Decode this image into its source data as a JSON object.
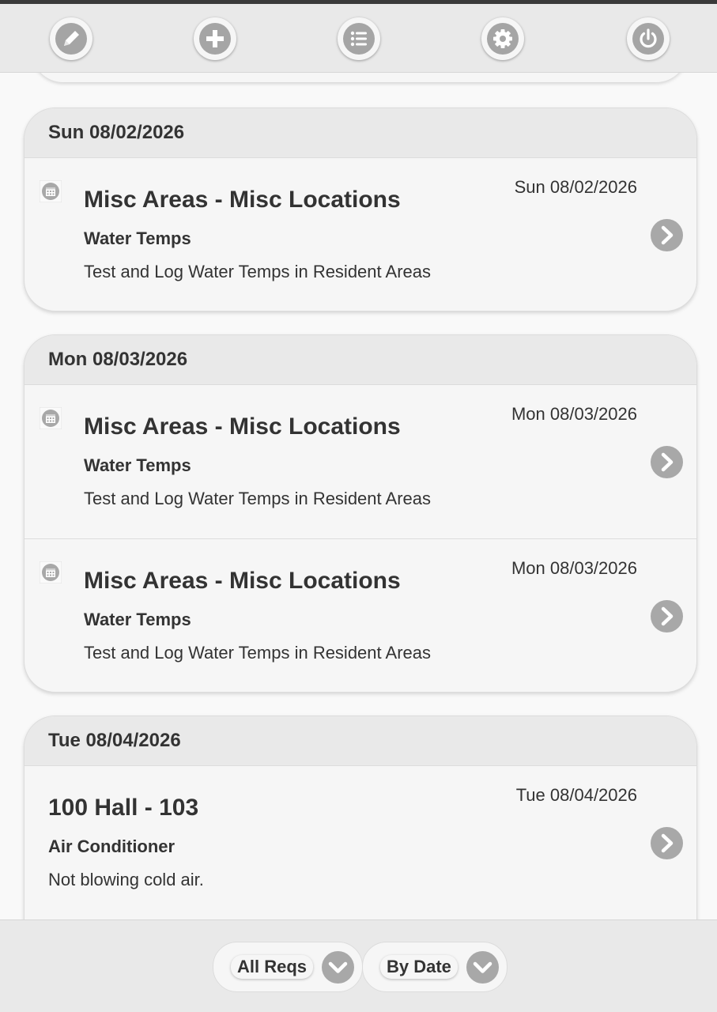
{
  "toolbar": {
    "buttons": [
      {
        "name": "edit",
        "icon": "pencil-icon"
      },
      {
        "name": "add",
        "icon": "plus-icon"
      },
      {
        "name": "list",
        "icon": "list-icon"
      },
      {
        "name": "settings",
        "icon": "gear-icon"
      },
      {
        "name": "logout",
        "icon": "power-icon"
      }
    ]
  },
  "groups": [
    {
      "header": "Sun 08/02/2026",
      "items": [
        {
          "icon": "calendar-icon",
          "date": "Sun 08/02/2026",
          "title": "Misc Areas - Misc Locations",
          "subtitle": "Water Temps",
          "description": "Test and Log Water Temps in Resident Areas"
        }
      ]
    },
    {
      "header": "Mon 08/03/2026",
      "items": [
        {
          "icon": "calendar-icon",
          "date": "Mon 08/03/2026",
          "title": "Misc Areas - Misc Locations",
          "subtitle": "Water Temps",
          "description": "Test and Log Water Temps in Resident Areas"
        },
        {
          "icon": "calendar-icon",
          "date": "Mon 08/03/2026",
          "title": "Misc Areas - Misc Locations",
          "subtitle": "Water Temps",
          "description": "Test and Log Water Temps in Resident Areas"
        }
      ]
    },
    {
      "header": "Tue 08/04/2026",
      "items": [
        {
          "icon": "",
          "date": "Tue 08/04/2026",
          "title": "100 Hall - 103",
          "subtitle": "Air Conditioner",
          "description": "Not blowing cold air."
        }
      ]
    }
  ],
  "footer": {
    "filter_label": "All Reqs",
    "sort_label": "By Date"
  },
  "colors": {
    "bar": "#e9e9e9",
    "card": "#f6f6f6",
    "icon_gray": "#a8a8a8",
    "text": "#333333"
  }
}
